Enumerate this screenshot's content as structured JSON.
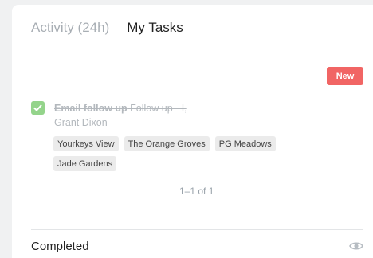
{
  "tabs": [
    {
      "label": "Activity (24h)",
      "active": false
    },
    {
      "label": "My Tasks",
      "active": true
    }
  ],
  "new_button": {
    "label": "New",
    "color": "#f16564"
  },
  "task": {
    "done": true,
    "title_bold": "Email follow up",
    "title_rest": " Follow up - I, Grant Dixon",
    "tags": [
      "Yourkeys View",
      "The Orange Groves",
      "PG Meadows",
      "Jade Gardens"
    ]
  },
  "pagination": {
    "text": "1–1 of 1"
  },
  "completed_section": {
    "label": "Completed",
    "icon": "eye-icon"
  },
  "colors": {
    "checkbox": "#94d48b",
    "background": "#f0f1f2"
  }
}
